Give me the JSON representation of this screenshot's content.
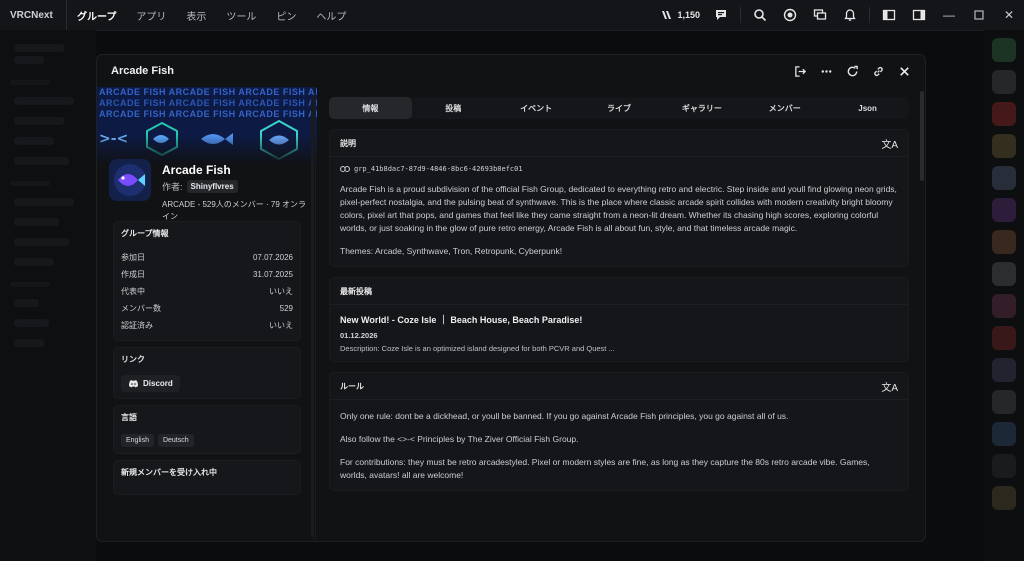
{
  "app": {
    "name": "VRCNext"
  },
  "menu": [
    {
      "label": "グループ",
      "active": true
    },
    {
      "label": "アプリ"
    },
    {
      "label": "表示"
    },
    {
      "label": "ツール"
    },
    {
      "label": "ピン"
    },
    {
      "label": "ヘルプ"
    }
  ],
  "topbar": {
    "credits": "1,150"
  },
  "modal": {
    "title": "Arcade Fish",
    "banner_text": "ARCADE FISH ARCADE FISH ARCADE FISH ARCADE FISH ARCADE"
  },
  "group": {
    "name": "Arcade Fish",
    "owner_label": "作者:",
    "owner": "Shinyflvres",
    "stats": "ARCADE - 529人のメンバー · 79 オンライン"
  },
  "info": {
    "title": "グループ情報",
    "rows": [
      {
        "label": "参加日",
        "value": "07.07.2026"
      },
      {
        "label": "作成日",
        "value": "31.07.2025"
      },
      {
        "label": "代表中",
        "value": "いいえ"
      },
      {
        "label": "メンバー数",
        "value": "529"
      },
      {
        "label": "認証済み",
        "value": "いいえ"
      }
    ]
  },
  "links": {
    "title": "リンク",
    "discord": "Discord"
  },
  "languages": {
    "title": "言語",
    "items": [
      "English",
      "Deutsch"
    ]
  },
  "recruit": {
    "title": "新規メンバーを受け入れ中"
  },
  "tabs": [
    "情報",
    "投稿",
    "イベント",
    "ライブ",
    "ギャラリー",
    "メンバー",
    "Json"
  ],
  "description": {
    "title": "説明",
    "group_id": "grp_41b8dac7-87d9-4846-8bc6-42693b8efc01",
    "text": "Arcade Fish is a proud subdivision of the official Fish Group, dedicated to everything retro and electric. Step inside and youll find glowing neon grids, pixel-perfect nostalgia, and the pulsing beat of synthwave. This is the place where classic arcade spirit collides with modern creativity bright bloomy colors, pixel art that pops, and games that feel like they came straight from a neon-lit dream. Whether its chasing high scores, exploring colorful worlds, or just soaking in the glow of pure retro energy, Arcade Fish is all about fun, style, and that timeless arcade magic.",
    "themes": "Themes: Arcade, Synthwave, Tron, Retropunk, Cyberpunk!"
  },
  "latest_post": {
    "title": "最新投稿",
    "post_title": "New World! - Coze Isle ｜ Beach House, Beach Paradise!",
    "date": "01.12.2026",
    "desc": "Description: Coze Isle is an optimized island designed for both PCVR and Quest ..."
  },
  "rules": {
    "title": "ルール",
    "p1": "Only one rule: dont be a dickhead, or youll be banned. If you go against Arcade Fish principles, you go against all of us.",
    "p2": "Also follow the <>-< Principles by The Ziver Official Fish Group.",
    "p3": "For contributions: they must be retro arcadestyled. Pixel or modern styles are fine, as long as they capture the 80s retro arcade vibe. Games, worlds, avatars! all are welcome!"
  },
  "colors": {
    "accent": "#3b6bd6",
    "bg": "#0b0c0e",
    "card": "#151619"
  }
}
